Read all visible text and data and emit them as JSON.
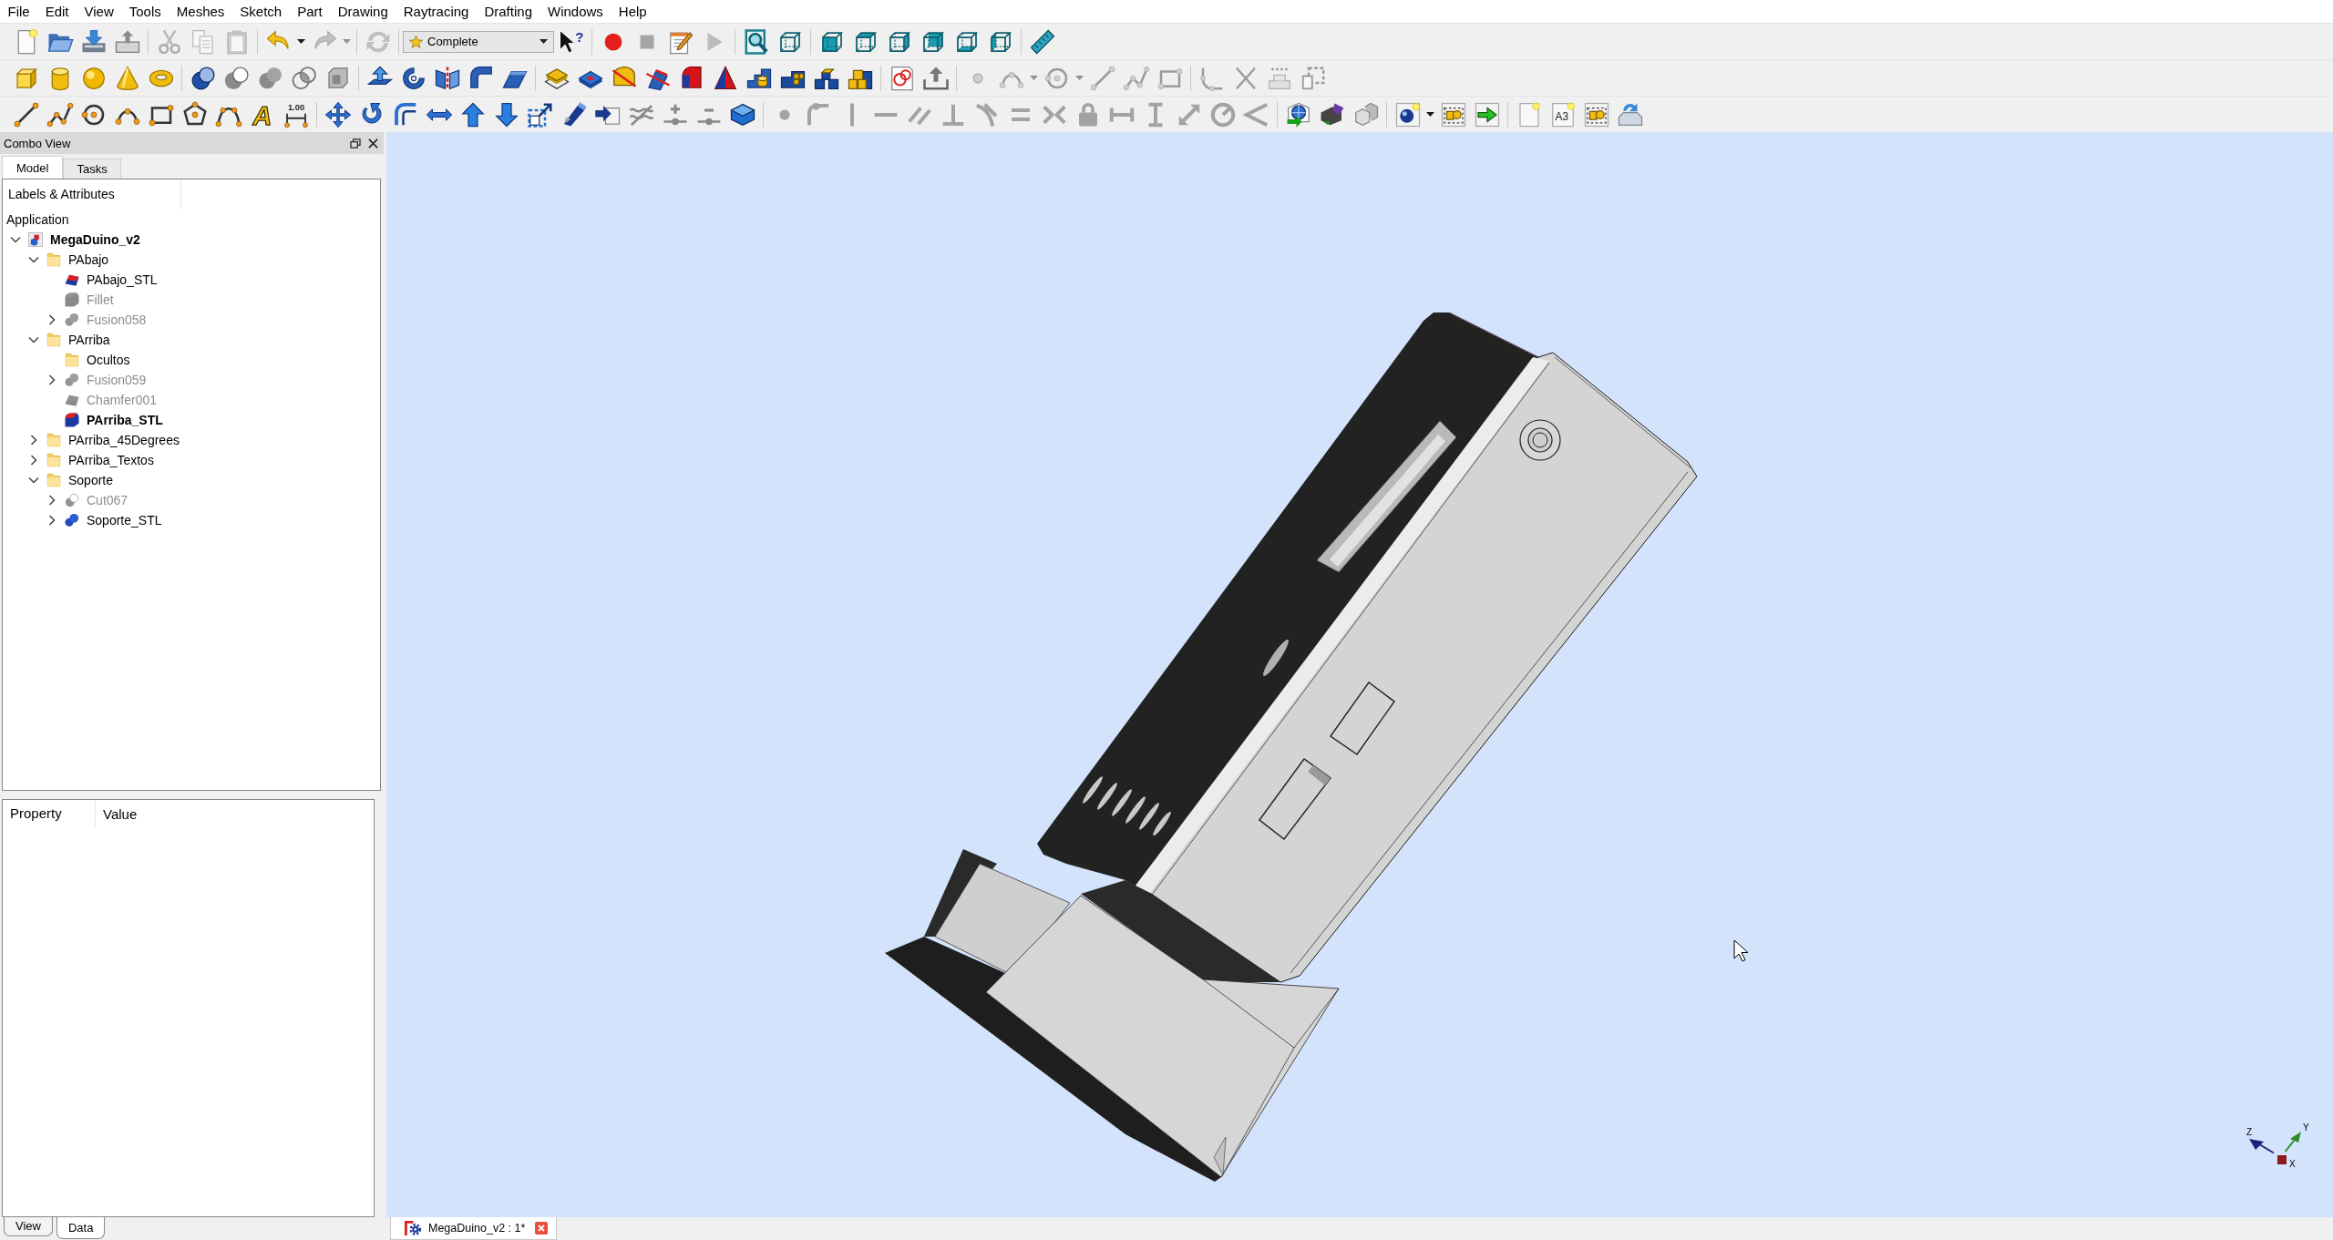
{
  "menu": [
    "File",
    "Edit",
    "View",
    "Tools",
    "Meshes",
    "Sketch",
    "Part",
    "Drawing",
    "Raytracing",
    "Drafting",
    "Windows",
    "Help"
  ],
  "toolbar_rows": [
    {
      "groups": [
        {
          "tools": [
            {
              "kind": "newdoc",
              "disabled": false
            },
            {
              "kind": "open",
              "disabled": false
            },
            {
              "kind": "save",
              "disabled": false
            },
            {
              "kind": "print",
              "disabled": false
            }
          ]
        },
        {
          "tools": [
            {
              "kind": "cut",
              "disabled": true
            },
            {
              "kind": "copy",
              "disabled": true
            },
            {
              "kind": "paste",
              "disabled": true
            }
          ]
        },
        {
          "tools": [
            {
              "kind": "undo",
              "disabled": false
            },
            {
              "kind": "caret",
              "disabled": false
            },
            {
              "kind": "redo",
              "disabled": true
            },
            {
              "kind": "caret",
              "disabled": true
            }
          ]
        },
        {
          "tools": [
            {
              "kind": "refresh",
              "disabled": true
            }
          ]
        },
        {
          "tools": [
            {
              "kind": "combo",
              "disabled": false,
              "value": "Complete"
            },
            {
              "kind": "whatsthis",
              "disabled": false,
              "glyph": "?"
            }
          ]
        },
        {
          "tools": [
            {
              "kind": "record",
              "disabled": false
            },
            {
              "kind": "stop",
              "disabled": true
            },
            {
              "kind": "macroedit",
              "disabled": false
            },
            {
              "kind": "play",
              "disabled": true
            }
          ]
        },
        {
          "tools": [
            {
              "kind": "fitall",
              "disabled": false
            },
            {
              "kind": "viewiso",
              "disabled": false
            }
          ]
        },
        {
          "tools": [
            {
              "kind": "viewfront",
              "disabled": false
            },
            {
              "kind": "viewtop",
              "disabled": false
            },
            {
              "kind": "viewright",
              "disabled": false
            },
            {
              "kind": "viewrear",
              "disabled": false
            },
            {
              "kind": "viewbottom",
              "disabled": false
            },
            {
              "kind": "viewleft",
              "disabled": false
            }
          ]
        },
        {
          "tools": [
            {
              "kind": "measure",
              "disabled": false
            }
          ]
        }
      ]
    },
    {
      "groups": [
        {
          "tools": [
            {
              "kind": "box",
              "disabled": false
            },
            {
              "kind": "cylinder",
              "disabled": false
            },
            {
              "kind": "sphere",
              "disabled": false
            },
            {
              "kind": "cone",
              "disabled": false
            },
            {
              "kind": "torus",
              "disabled": false
            }
          ]
        },
        {
          "tools": [
            {
              "kind": "boolean",
              "disabled": false
            },
            {
              "kind": "cutop",
              "disabled": false
            },
            {
              "kind": "fuse",
              "disabled": false
            },
            {
              "kind": "common",
              "disabled": false
            },
            {
              "kind": "shell",
              "disabled": false
            }
          ]
        },
        {
          "tools": [
            {
              "kind": "extrude",
              "disabled": false
            },
            {
              "kind": "revolve",
              "disabled": false
            },
            {
              "kind": "mirror",
              "disabled": false
            },
            {
              "kind": "fillet",
              "disabled": false
            },
            {
              "kind": "chamfer",
              "disabled": false
            }
          ]
        },
        {
          "tools": [
            {
              "kind": "faceframe",
              "disabled": false
            },
            {
              "kind": "ruled",
              "disabled": false
            },
            {
              "kind": "loft",
              "disabled": false
            },
            {
              "kind": "sweep",
              "disabled": false
            },
            {
              "kind": "section",
              "disabled": false
            },
            {
              "kind": "wedge",
              "disabled": false
            },
            {
              "kind": "stairs",
              "disabled": false
            },
            {
              "kind": "blocks",
              "disabled": false
            },
            {
              "kind": "cubes",
              "disabled": false
            },
            {
              "kind": "cubestack",
              "disabled": false
            }
          ]
        },
        {
          "tools": [
            {
              "kind": "drawingpage",
              "disabled": false
            },
            {
              "kind": "exportup",
              "disabled": false
            }
          ]
        },
        {
          "tools": [
            {
              "kind": "point",
              "disabled": true
            },
            {
              "kind": "arc",
              "disabled": true
            },
            {
              "kind": "caret",
              "disabled": true
            },
            {
              "kind": "circle",
              "disabled": true
            },
            {
              "kind": "caret",
              "disabled": true
            },
            {
              "kind": "line",
              "disabled": true
            },
            {
              "kind": "polyline",
              "disabled": true
            },
            {
              "kind": "rectangle",
              "disabled": true
            }
          ]
        },
        {
          "tools": [
            {
              "kind": "sketchfillet",
              "disabled": true
            },
            {
              "kind": "trim",
              "disabled": true
            },
            {
              "kind": "external",
              "disabled": true
            },
            {
              "kind": "construction",
              "disabled": true
            }
          ]
        }
      ]
    },
    {
      "groups": [
        {
          "tools": [
            {
              "kind": "line",
              "disabled": false
            },
            {
              "kind": "polyline",
              "disabled": false
            },
            {
              "kind": "circle",
              "disabled": false
            },
            {
              "kind": "arc",
              "disabled": false
            },
            {
              "kind": "rectangle",
              "disabled": false
            },
            {
              "kind": "polygon",
              "disabled": false
            },
            {
              "kind": "bspline",
              "disabled": false
            },
            {
              "kind": "text",
              "disabled": false,
              "glyph": "A"
            },
            {
              "kind": "dimension",
              "disabled": false,
              "glyph": "1.00"
            }
          ]
        },
        {
          "tools": [
            {
              "kind": "move",
              "disabled": false
            },
            {
              "kind": "rotate",
              "disabled": false
            },
            {
              "kind": "offset",
              "disabled": false
            },
            {
              "kind": "stretch",
              "disabled": false
            },
            {
              "kind": "upgrade",
              "disabled": false
            },
            {
              "kind": "downgrade",
              "disabled": false
            },
            {
              "kind": "scale",
              "disabled": false
            },
            {
              "kind": "shape2d",
              "disabled": false
            },
            {
              "kind": "tosketch",
              "disabled": false
            },
            {
              "kind": "wave",
              "disabled": false
            },
            {
              "kind": "addpoint",
              "disabled": false
            },
            {
              "kind": "delpoint",
              "disabled": false
            },
            {
              "kind": "block",
              "disabled": false
            }
          ]
        },
        {
          "tools": [
            {
              "kind": "coincident",
              "disabled": true
            },
            {
              "kind": "pointon",
              "disabled": true
            },
            {
              "kind": "vertical",
              "disabled": true
            },
            {
              "kind": "horizontal",
              "disabled": true
            },
            {
              "kind": "parallel",
              "disabled": true
            },
            {
              "kind": "perpendicular",
              "disabled": true
            },
            {
              "kind": "tangent",
              "disabled": true
            },
            {
              "kind": "equal",
              "disabled": true
            },
            {
              "kind": "symmetric",
              "disabled": true
            },
            {
              "kind": "lock",
              "disabled": true
            },
            {
              "kind": "hdistance",
              "disabled": true
            },
            {
              "kind": "vdistance",
              "disabled": true
            },
            {
              "kind": "distance",
              "disabled": true
            },
            {
              "kind": "radius",
              "disabled": true
            },
            {
              "kind": "angle",
              "disabled": true
            }
          ]
        },
        {
          "tools": [
            {
              "kind": "globe",
              "disabled": false
            },
            {
              "kind": "camera",
              "disabled": false
            },
            {
              "kind": "greycubes",
              "disabled": false
            }
          ]
        },
        {
          "tools": [
            {
              "kind": "povproject",
              "disabled": false
            },
            {
              "kind": "caret",
              "disabled": false
            },
            {
              "kind": "exportpart",
              "disabled": false
            },
            {
              "kind": "render",
              "disabled": false
            }
          ]
        },
        {
          "tools": [
            {
              "kind": "blankpage",
              "disabled": false
            },
            {
              "kind": "a3page",
              "disabled": false,
              "glyph": "A3"
            },
            {
              "kind": "exportpart",
              "disabled": false
            },
            {
              "kind": "exportpage",
              "disabled": false
            }
          ]
        }
      ]
    }
  ],
  "combo_view": {
    "title": "Combo View",
    "tabs": [
      {
        "label": "Model",
        "selected": true
      },
      {
        "label": "Tasks",
        "selected": false
      }
    ],
    "tree": {
      "header": "Labels & Attributes",
      "root": "Application",
      "items": [
        {
          "label": "MegaDuino_v2",
          "kind": "document",
          "expanded": true,
          "hidden": false,
          "active": true,
          "children": [
            {
              "label": "PAbajo",
              "kind": "folder",
              "expanded": true,
              "hidden": false,
              "active": false,
              "children": [
                {
                  "label": "PAbajo_STL",
                  "kind": "chamfer",
                  "hidden": false,
                  "active": false
                },
                {
                  "label": "Fillet",
                  "kind": "fillet",
                  "hidden": true,
                  "active": false
                },
                {
                  "label": "Fusion058",
                  "kind": "fusion",
                  "expanded": false,
                  "hidden": true,
                  "active": false
                }
              ]
            },
            {
              "label": "PArriba",
              "kind": "folder",
              "expanded": true,
              "hidden": false,
              "active": false,
              "children": [
                {
                  "label": "Ocultos",
                  "kind": "folder",
                  "hidden": false,
                  "active": false
                },
                {
                  "label": "Fusion059",
                  "kind": "fusion",
                  "expanded": false,
                  "hidden": true,
                  "active": false
                },
                {
                  "label": "Chamfer001",
                  "kind": "chamfer",
                  "hidden": true,
                  "active": false
                },
                {
                  "label": "PArriba_STL",
                  "kind": "fillet",
                  "hidden": false,
                  "active": true
                }
              ]
            },
            {
              "label": "PArriba_45Degrees",
              "kind": "folder",
              "expanded": false,
              "hidden": false,
              "active": false
            },
            {
              "label": "PArriba_Textos",
              "kind": "folder",
              "expanded": false,
              "hidden": false,
              "active": false
            },
            {
              "label": "Soporte",
              "kind": "folder",
              "expanded": true,
              "hidden": false,
              "active": false,
              "children": [
                {
                  "label": "Cut067",
                  "kind": "cut",
                  "expanded": false,
                  "hidden": true,
                  "active": false
                },
                {
                  "label": "Soporte_STL",
                  "kind": "fusion",
                  "expanded": false,
                  "hidden": false,
                  "active": false
                }
              ]
            }
          ]
        }
      ]
    }
  },
  "property_view": {
    "columns": [
      "Property",
      "Value"
    ],
    "tabs": [
      {
        "label": "View",
        "selected": false
      },
      {
        "label": "Data",
        "selected": true
      }
    ]
  },
  "document_tabs": [
    {
      "label": "MegaDuino_v2 : 1*",
      "selected": true
    }
  ],
  "viewport": {
    "axes": [
      {
        "label": "Z",
        "color": "#1a237e"
      },
      {
        "label": "Y",
        "color": "#2e8b22"
      },
      {
        "label": "X",
        "color": "#8b1a1a"
      }
    ]
  }
}
